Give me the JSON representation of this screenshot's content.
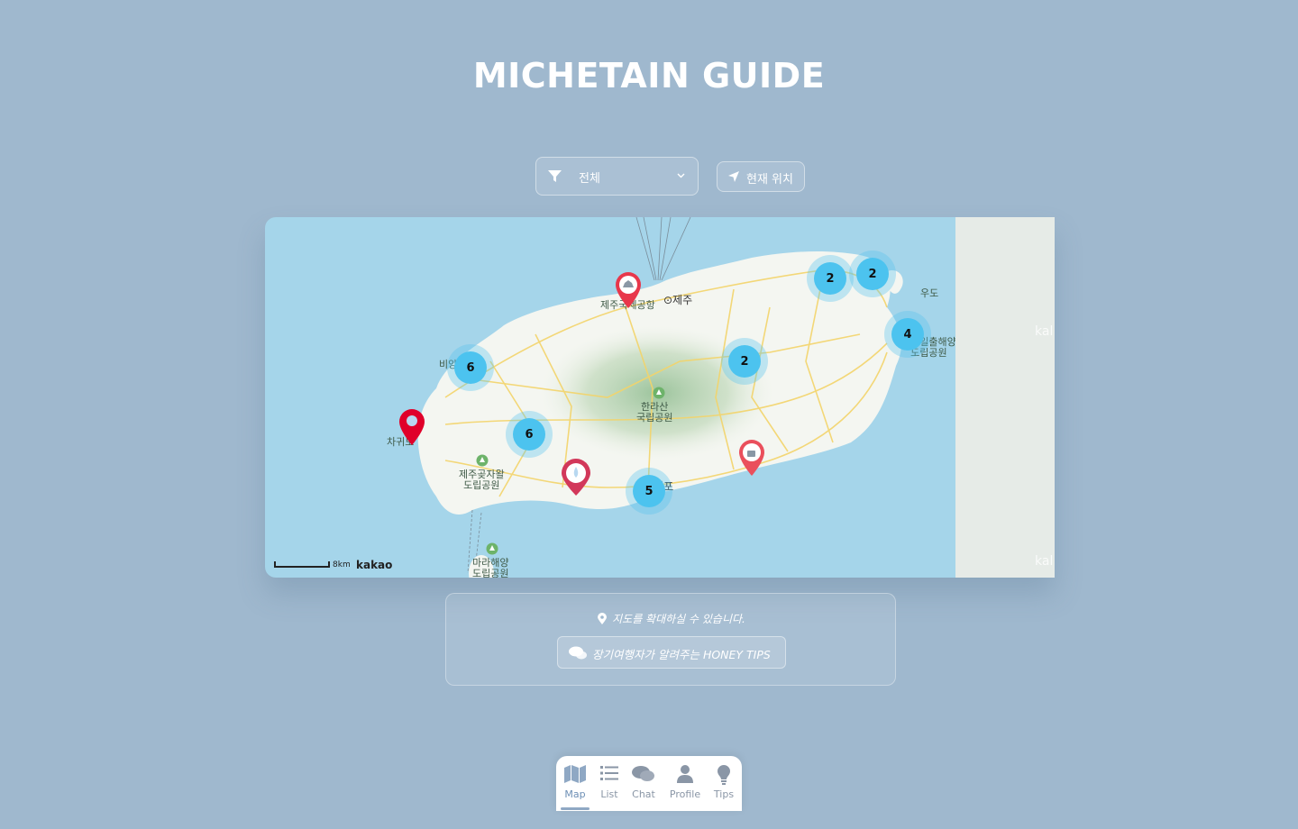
{
  "app": {
    "title": "MICHETAIN GUIDE"
  },
  "filter": {
    "selected": "전체",
    "icon": "filter-icon"
  },
  "locate_button": {
    "label": "현재 위치",
    "icon": "location-arrow-icon"
  },
  "map": {
    "labels": {
      "jeju_city": "⊙제주",
      "airport": "제주국제공항",
      "udo": "우도",
      "hallasan": "한라산\n국립공원",
      "jeju_gotjawal": "제주곶자왈\n도립공원",
      "marine_park_east": "성산일출해양\n도립공원",
      "marado": "마라해양\n도립공원",
      "biyangdo": "비양도",
      "chagwido": "차귀도",
      "seogwipo": "⊙서귀포"
    },
    "clusters": [
      {
        "id": "west-coast",
        "count": "6"
      },
      {
        "id": "southwest",
        "count": "6"
      },
      {
        "id": "seogwipo",
        "count": "5"
      },
      {
        "id": "central-east",
        "count": "2"
      },
      {
        "id": "northeast-1",
        "count": "2"
      },
      {
        "id": "northeast-2",
        "count": "2"
      },
      {
        "id": "east-coast",
        "count": "4"
      }
    ],
    "scale_label": "8km",
    "provider_logo": "kakao",
    "ghost_text": "kal"
  },
  "info": {
    "hint": "지도를 확대하실 수 있습니다.",
    "tips_button": "장기여행자가 알려주는 HONEY TIPS"
  },
  "nav": {
    "items": [
      {
        "label": "Map",
        "icon": "map-icon"
      },
      {
        "label": "List",
        "icon": "list-icon"
      },
      {
        "label": "Chat",
        "icon": "chat-icon"
      },
      {
        "label": "Profile",
        "icon": "profile-icon"
      },
      {
        "label": "Tips",
        "icon": "lightbulb-icon"
      }
    ],
    "active": "Map"
  },
  "colors": {
    "background": "#9fb8ce",
    "sea": "#a5d5ea",
    "cluster": "#4cc3ef",
    "marker_red": "#e8374b"
  }
}
